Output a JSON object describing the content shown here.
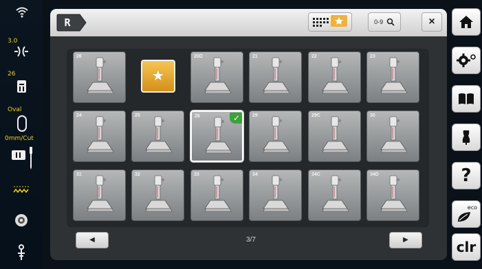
{
  "left_bar": {
    "stitch_width": "3.0",
    "foot_number": "26",
    "buttonhole_shape": "Oval",
    "cut_length": "0mm/Cut",
    "icons": [
      "wifi-icon",
      "stitch-width-icon",
      "presser-foot-icon",
      "oval-buttonhole-icon",
      "needle-plate-icon",
      "zigzag-stitch-icon",
      "bobbin-icon",
      "needle-icon"
    ]
  },
  "header": {
    "foot_tab_letter": "R",
    "zoom_label": "0-9",
    "close_label": "×"
  },
  "feet": [
    {
      "num": "26",
      "selected": false
    },
    {
      "num": "20D",
      "selected": false
    },
    {
      "num": "21",
      "selected": false
    },
    {
      "num": "22",
      "selected": false
    },
    {
      "num": "23",
      "selected": false
    },
    {
      "num": "24",
      "selected": false
    },
    {
      "num": "25",
      "selected": false
    },
    {
      "num": "26",
      "selected": true
    },
    {
      "num": "29",
      "selected": false
    },
    {
      "num": "29C",
      "selected": false
    },
    {
      "num": "30",
      "selected": false
    },
    {
      "num": "31",
      "selected": false
    },
    {
      "num": "32",
      "selected": false
    },
    {
      "num": "33",
      "selected": false
    },
    {
      "num": "34",
      "selected": false
    },
    {
      "num": "34C",
      "selected": false
    },
    {
      "num": "34D",
      "selected": false
    }
  ],
  "pagination": {
    "prev_label": "◀",
    "next_label": "▶",
    "indicator": "3/7"
  },
  "right_bar": {
    "clear_label": "clr",
    "eco_label": "eco",
    "help_label": "?"
  },
  "colors": {
    "favorite_accent": "#f2b238",
    "check_accent": "#3aa33a"
  }
}
